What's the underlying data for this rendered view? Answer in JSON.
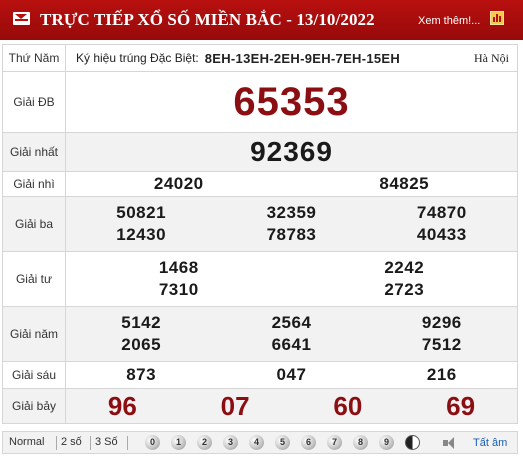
{
  "header": {
    "title": "TRỰC TIẾP XỔ SỐ MIỀN BẮC - 13/10/2022",
    "more_link": "Xem thêm!..."
  },
  "meta": {
    "label": "Thứ Năm",
    "code_prefix": "Ký hiệu trúng Đặc Biệt:",
    "code": "8EH-13EH-2EH-9EH-7EH-15EH",
    "city": "Hà Nội"
  },
  "prizes": {
    "db": {
      "label": "Giải ĐB",
      "numbers": [
        "65353"
      ]
    },
    "g1": {
      "label": "Giải nhất",
      "numbers": [
        "92369"
      ]
    },
    "g2": {
      "label": "Giải nhì",
      "numbers": [
        "24020",
        "84825"
      ]
    },
    "g3": {
      "label": "Giải ba",
      "numbers": [
        "50821",
        "32359",
        "74870",
        "12430",
        "78783",
        "40433"
      ]
    },
    "g4": {
      "label": "Giải tư",
      "numbers": [
        "1468",
        "2242",
        "7310",
        "2723"
      ]
    },
    "g5": {
      "label": "Giải năm",
      "numbers": [
        "5142",
        "2564",
        "9296",
        "2065",
        "6641",
        "7512"
      ]
    },
    "g6": {
      "label": "Giải sáu",
      "numbers": [
        "873",
        "047",
        "216"
      ]
    },
    "g7": {
      "label": "Giải bảy",
      "numbers": [
        "96",
        "07",
        "60",
        "69"
      ]
    }
  },
  "footer": {
    "tabs": [
      "Normal",
      "2 số",
      "3 Số"
    ],
    "digits": [
      "0",
      "1",
      "2",
      "3",
      "4",
      "5",
      "6",
      "7",
      "8",
      "9"
    ],
    "all_label": "Tất âm"
  },
  "colors": {
    "header_bg": "#b8100f",
    "special_prize": "#8b0f12",
    "row_alt": "#f2f2f2"
  }
}
